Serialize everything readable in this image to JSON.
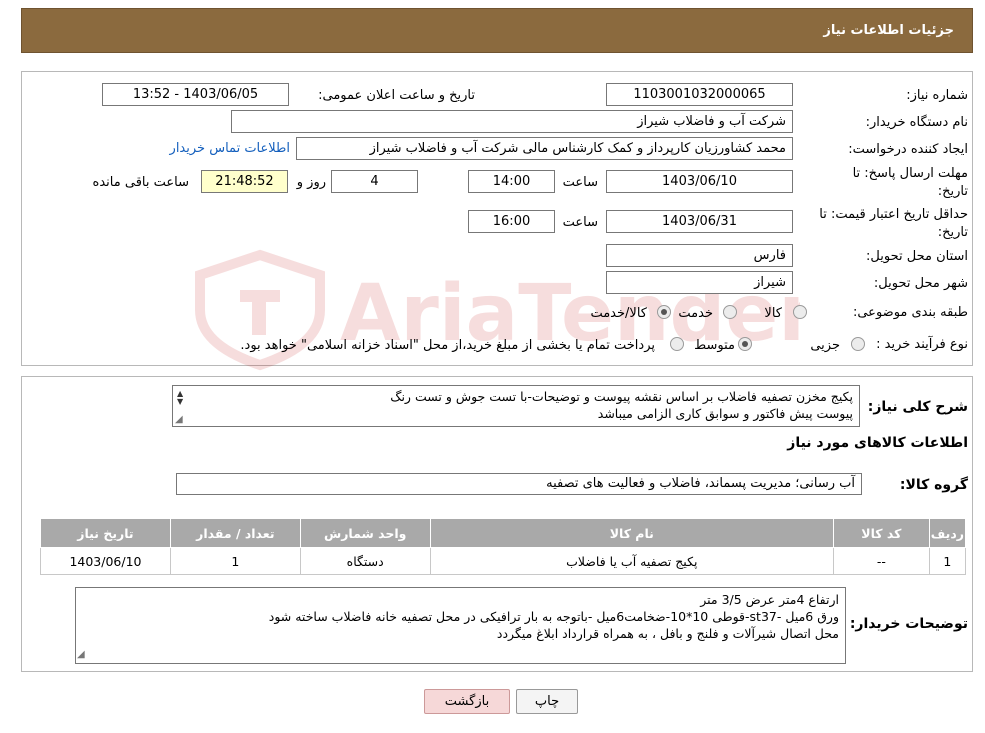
{
  "page": {
    "title": "جزئیات اطلاعات نیاز"
  },
  "fields": {
    "need_number_label": "شماره نیاز:",
    "need_number": "1103001032000065",
    "announce_label": "تاریخ و ساعت اعلان عمومی:",
    "announce_value": "1403/06/05 - 13:52",
    "buyer_label": "نام دستگاه خریدار:",
    "buyer_value": "شرکت آب و فاضلاب شیراز",
    "creator_label": "ایجاد کننده درخواست:",
    "creator_value": "محمد کشاورزیان کارپرداز و کمک کارشناس مالی شرکت آب و فاضلاب شیراز",
    "contact_link": "اطلاعات تماس خریدار",
    "deadline_label_1": "مهلت ارسال پاسخ: تا",
    "deadline_label_2": "تاریخ:",
    "deadline_date": "1403/06/10",
    "time_label": "ساعت",
    "deadline_time": "14:00",
    "days_value": "4",
    "days_label": "روز و",
    "remaining_time": "21:48:52",
    "remaining_label": "ساعت باقی مانده",
    "validity_label_1": "حداقل تاریخ اعتبار قیمت: تا",
    "validity_label_2": "تاریخ:",
    "validity_date": "1403/06/31",
    "validity_time": "16:00",
    "province_label": "استان محل تحویل:",
    "province_value": "فارس",
    "city_label": "شهر محل تحویل:",
    "city_value": "شیراز",
    "category_label": "طبقه بندی موضوعی:",
    "category_options": [
      "کالا",
      "خدمت",
      "کالا/خدمت"
    ],
    "process_label": "نوع فرآیند خرید :",
    "process_options": [
      "جزیی",
      "متوسط"
    ],
    "process_note": "پرداخت تمام یا بخشی از مبلغ خرید،از محل \"اسناد خزانه اسلامی\" خواهد بود."
  },
  "description": {
    "label": "شرح کلی نیاز:",
    "line1": "پکیج مخزن تصفیه فاضلاب بر اساس نقشه پیوست و توضیحات-با تست جوش و تست رنگ",
    "line2": "پیوست پیش فاکتور و سوابق کاری الزامی میباشد"
  },
  "goods": {
    "section_title": "اطلاعات کالاهای مورد نیاز",
    "group_label": "گروه کالا:",
    "group_value": "آب رسانی؛ مدیریت پسماند، فاضلاب و فعالیت های تصفیه"
  },
  "table": {
    "headers": [
      "ردیف",
      "کد کالا",
      "نام کالا",
      "واحد شمارش",
      "تعداد / مقدار",
      "تاریخ نیاز"
    ],
    "rows": [
      [
        "1",
        "--",
        "پکیج تصفیه آب یا فاضلاب",
        "دستگاه",
        "1",
        "1403/06/10"
      ]
    ]
  },
  "buyer_notes": {
    "label": "توضیحات خریدار:",
    "line1": "ارتفاع 4متر عرض 3/5 متر",
    "line2": "ورق 6میل -st37-قوطی 10*10-ضخامت6میل -باتوجه به بار ترافیکی در محل تصفیه خانه فاضلاب ساخته شود",
    "line3": "محل اتصال شیرآلات و فلنج و بافل ، به همراه قرارداد ابلاغ میگردد"
  },
  "buttons": {
    "print": "چاپ",
    "back": "بازگشت"
  },
  "watermark": {
    "text": "AriaTender.neT"
  },
  "colors": {
    "header": "#8b6a3e",
    "back_button": "#f6d8d8",
    "remaining_bg": "#ffffcc",
    "link": "#1560bd"
  }
}
